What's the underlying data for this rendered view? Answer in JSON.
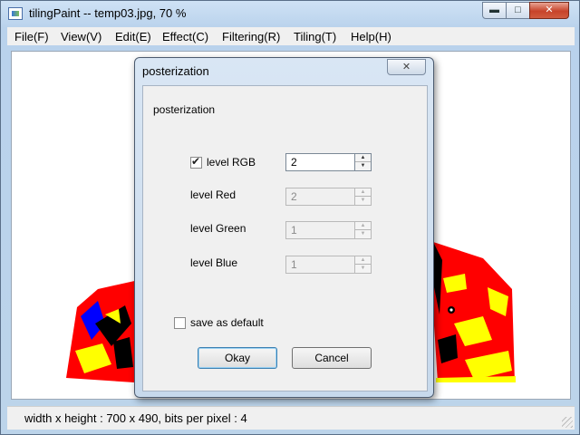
{
  "window": {
    "title": "tilingPaint -- temp03.jpg, 70 %",
    "minimize_glyph": "▬",
    "maximize_glyph": "□",
    "close_glyph": "✕"
  },
  "menu": [
    {
      "label": "File(F)"
    },
    {
      "label": "View(V)"
    },
    {
      "label": "Edit(E)"
    },
    {
      "label": "Effect(C)"
    },
    {
      "label": "Filtering(R)"
    },
    {
      "label": "Tiling(T)"
    },
    {
      "label": "Help(H)"
    }
  ],
  "canvas": {
    "image_colors": {
      "red": "#ff0000",
      "yellow": "#ffff00",
      "black": "#000000",
      "blue": "#0000ff",
      "white": "#ffffff"
    }
  },
  "status": {
    "text": "width x height : 700 x 490, bits per pixel : 4"
  },
  "dialog": {
    "title": "posterization",
    "close_glyph": "✕",
    "heading": "posterization",
    "level_rgb": {
      "label": "level RGB",
      "checked": true,
      "value": "2"
    },
    "level_red": {
      "label": "level Red",
      "value": "2"
    },
    "level_green": {
      "label": "level Green",
      "value": "1"
    },
    "level_blue": {
      "label": "level Blue",
      "value": "1"
    },
    "save_default": {
      "label": "save as default",
      "checked": false
    },
    "ok_label": "Okay",
    "cancel_label": "Cancel"
  }
}
